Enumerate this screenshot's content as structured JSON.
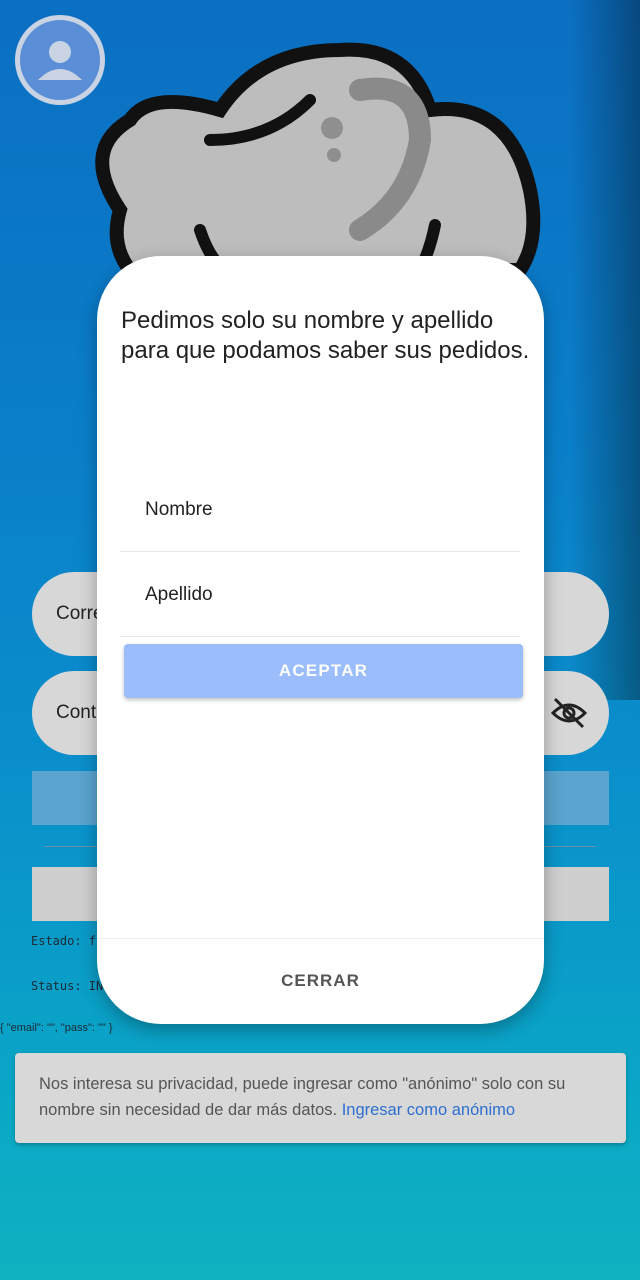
{
  "background_form": {
    "email_label": "Corre",
    "password_label": "Cont",
    "estado_text": "Estado: f",
    "status_text": "Status: IN",
    "json_debug": "{ \"email\": \"\", \"pass\": \"\" }",
    "privacy_text": "Nos interesa su privacidad, puede ingresar como \"anónimo\" solo con su nombre sin necesidad de dar más datos.",
    "privacy_link": "Ingresar como anónimo"
  },
  "dialog": {
    "message": "Pedimos solo su nombre y apellido para que podamos saber sus pedidos.",
    "nombre_placeholder": "Nombre",
    "apellido_placeholder": "Apellido",
    "accept_label": "ACEPTAR",
    "close_label": "CERRAR"
  },
  "colors": {
    "accept_button": "#9bbdfb",
    "link": "#2d6fd0",
    "background_top": "#0b6fc2",
    "background_bottom": "#0fb2c0"
  },
  "icons": [
    "user-avatar-icon",
    "eye-off-icon",
    "logo-mascot"
  ]
}
